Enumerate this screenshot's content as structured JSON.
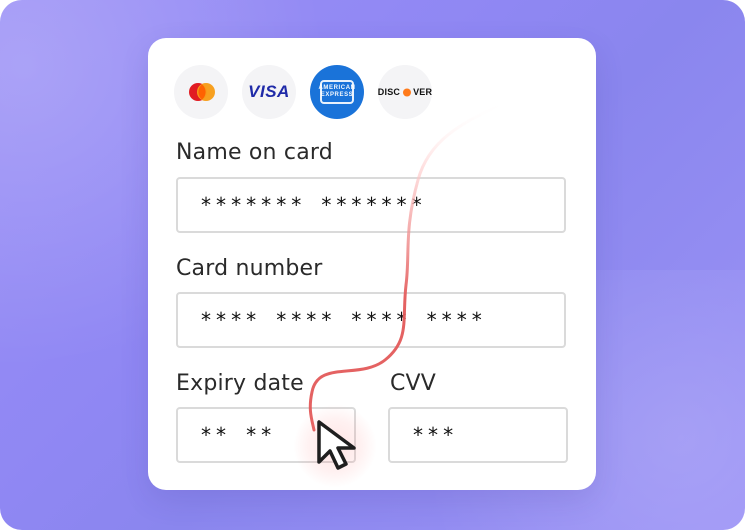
{
  "card": {
    "brands": [
      {
        "name": "mastercard"
      },
      {
        "name": "visa",
        "label": "VISA"
      },
      {
        "name": "american-express",
        "line1": "AMERICAN",
        "line2": "EXPRESS"
      },
      {
        "name": "discover",
        "label_prefix": "DISC",
        "label_suffix": "VER"
      }
    ],
    "fields": {
      "name_label": "Name on card",
      "name_value": "******* *******",
      "card_number_label": "Card number",
      "card_number_value": "****  ****  ****  ****",
      "expiry_label": "Expiry date",
      "expiry_value": "** **",
      "cvv_label": "CVV",
      "cvv_value": "***"
    }
  },
  "colors": {
    "path_red": "#e35a5a",
    "cursor_fill": "#ffffff",
    "cursor_stroke": "#1f1f1f",
    "mastercard_red": "#e11b22",
    "mastercard_orange": "#f79e1b",
    "visa_blue": "#1f2aa8",
    "amex_blue": "#1a73d9",
    "discover_orange": "#ff7a1a"
  },
  "icons": {
    "cursor": "arrow-cursor-icon",
    "mastercard": "mastercard-logo-icon",
    "visa": "visa-logo-icon",
    "amex": "amex-logo-icon",
    "discover": "discover-logo-icon"
  }
}
